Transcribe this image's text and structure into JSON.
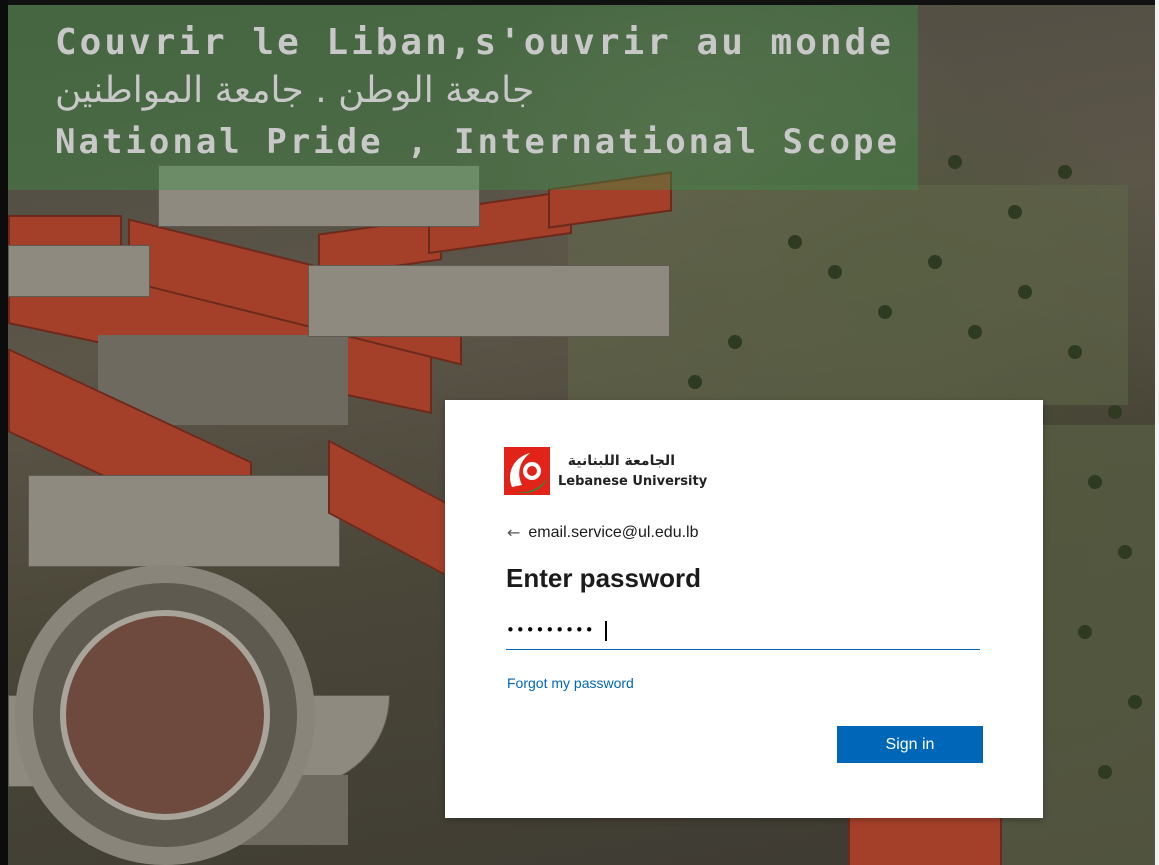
{
  "banner": {
    "line_fr": "Couvrir le Liban,s'ouvrir au monde",
    "line_ar": "جامعة الوطن . جامعة المواطنين",
    "line_en": "National Pride , International Scope"
  },
  "logo": {
    "arabic_name": "الجامعة اللبنانية",
    "english_name": "Lebanese University"
  },
  "login": {
    "identity_email": "email.service@ul.edu.lb",
    "title": "Enter password",
    "password_value": "•••••••••",
    "forgot_link": "Forgot my password",
    "signin_button": "Sign in"
  },
  "colors": {
    "accent": "#0067b8",
    "banner_green": "#3c8c46",
    "logo_red": "#e2231a",
    "logo_green": "#2e8b3a"
  },
  "icons": {
    "back": "left-arrow-icon",
    "logo": "lebanese-university-logo"
  }
}
